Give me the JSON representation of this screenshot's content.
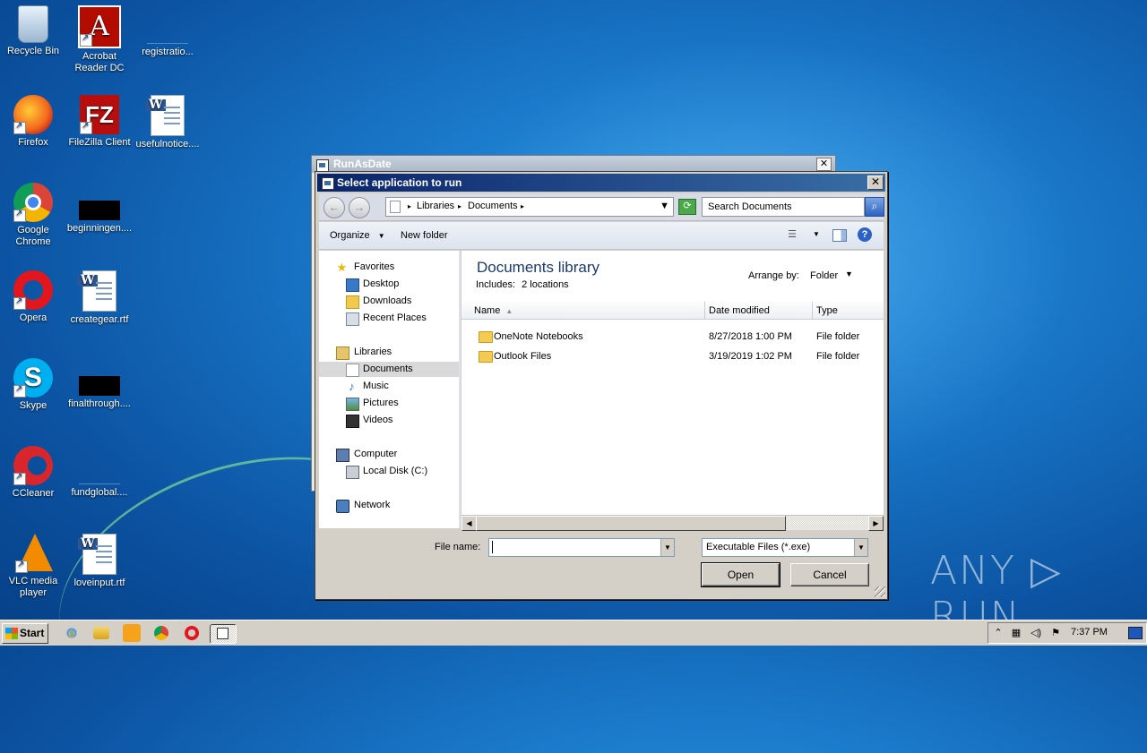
{
  "desktop": {
    "icons": [
      {
        "label": "Recycle Bin",
        "icon": "recycle-bin-icon"
      },
      {
        "label": "Acrobat Reader DC",
        "icon": "acrobat-icon"
      },
      {
        "label": "registratio...",
        "icon": "file-icon"
      },
      {
        "label": "Firefox",
        "icon": "firefox-icon"
      },
      {
        "label": "FileZilla Client",
        "icon": "filezilla-icon"
      },
      {
        "label": "usefulnotice....",
        "icon": "word-doc-icon"
      },
      {
        "label": "Google Chrome",
        "icon": "chrome-icon"
      },
      {
        "label": "beginningen....",
        "icon": "file-icon"
      },
      {
        "label": "Opera",
        "icon": "opera-icon"
      },
      {
        "label": "creategear.rtf",
        "icon": "word-doc-icon"
      },
      {
        "label": "Skype",
        "icon": "skype-icon"
      },
      {
        "label": "finalthrough....",
        "icon": "file-icon"
      },
      {
        "label": "CCleaner",
        "icon": "ccleaner-icon"
      },
      {
        "label": "fundglobal....",
        "icon": "file-icon"
      },
      {
        "label": "VLC media player",
        "icon": "vlc-icon"
      },
      {
        "label": "loveinput.rtf",
        "icon": "word-doc-icon"
      }
    ]
  },
  "back_window": {
    "title": "RunAsDate"
  },
  "dialog": {
    "title": "Select application to run",
    "address": {
      "segments": [
        "Libraries",
        "Documents"
      ]
    },
    "search_placeholder": "Search Documents",
    "toolbar": {
      "organize": "Organize",
      "new_folder": "New folder"
    },
    "sidebar": {
      "favorites": "Favorites",
      "desktop": "Desktop",
      "downloads": "Downloads",
      "recent_places": "Recent Places",
      "libraries": "Libraries",
      "documents": "Documents",
      "music": "Music",
      "pictures": "Pictures",
      "videos": "Videos",
      "computer": "Computer",
      "local_disk": "Local Disk (C:)",
      "network": "Network"
    },
    "library": {
      "title": "Documents library",
      "includes_label": "Includes:",
      "includes_value": "2 locations",
      "arrange_label": "Arrange by:",
      "arrange_value": "Folder"
    },
    "columns": {
      "name": "Name",
      "date": "Date modified",
      "type": "Type"
    },
    "files": [
      {
        "name": "OneNote Notebooks",
        "date": "8/27/2018 1:00 PM",
        "type": "File folder"
      },
      {
        "name": "Outlook Files",
        "date": "3/19/2019 1:02 PM",
        "type": "File folder"
      }
    ],
    "file_name_label": "File name:",
    "file_name_value": "",
    "filter_value": "Executable Files (*.exe)",
    "open_label": "Open",
    "cancel_label": "Cancel"
  },
  "watermark": "ANY ▷ RUN",
  "taskbar": {
    "start_label": "Start",
    "clock": "7:37 PM"
  }
}
